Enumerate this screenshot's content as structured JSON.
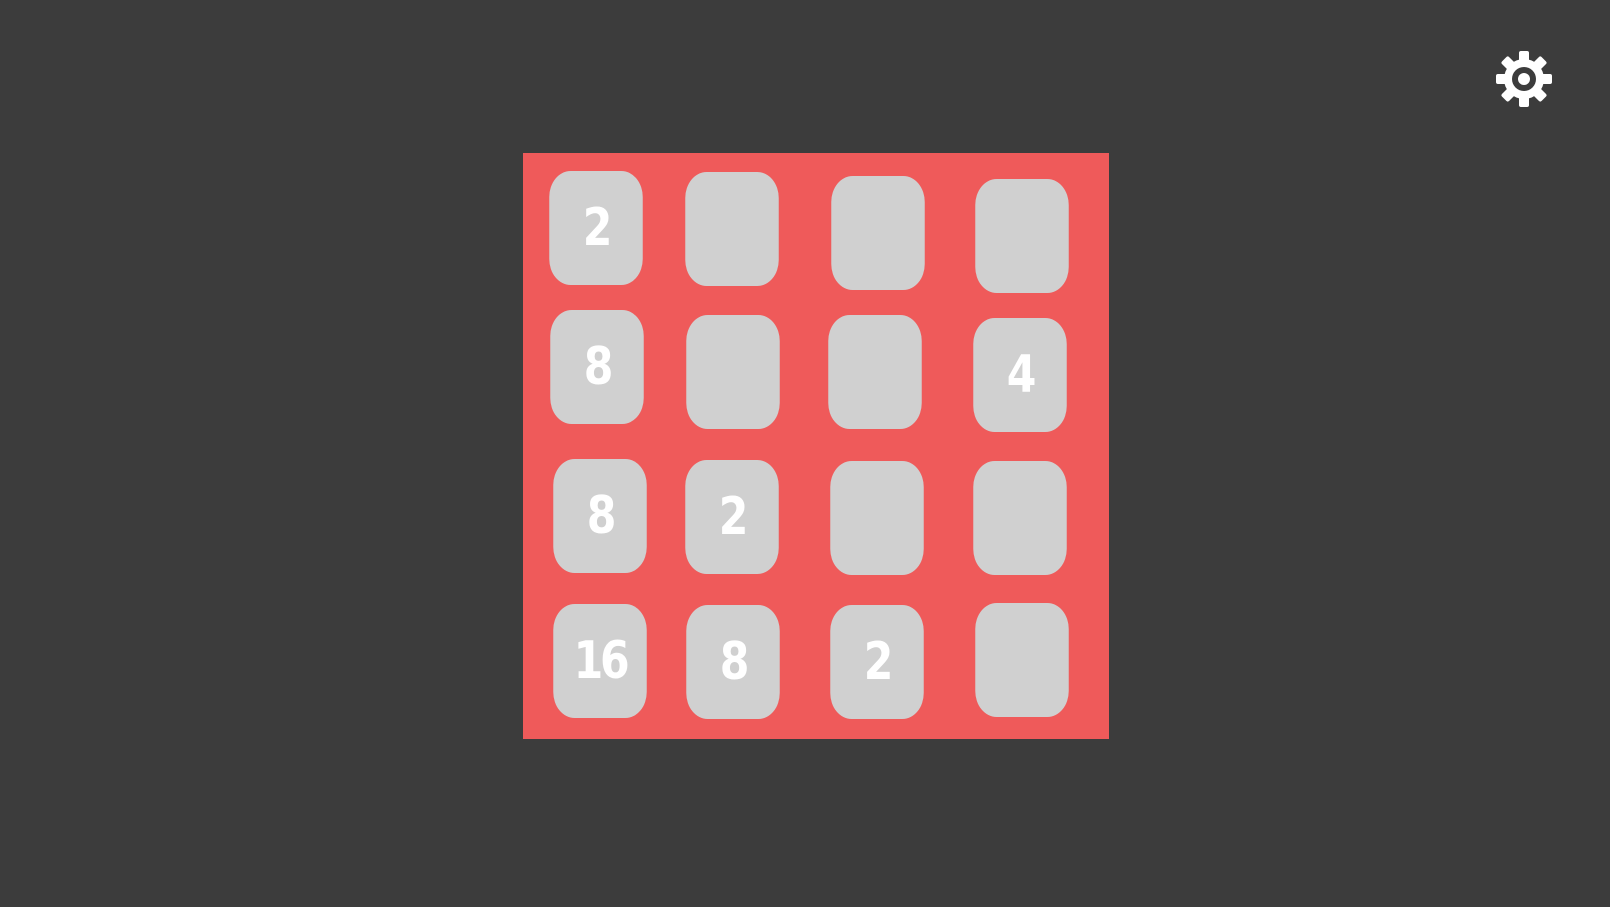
{
  "settings": {
    "icon": "gear-icon"
  },
  "board": {
    "size": 4,
    "background_color": "#ef5a5a",
    "tile_color": "#d0d0d0",
    "text_color": "#ffffff",
    "tiles": [
      [
        "2",
        "",
        "",
        ""
      ],
      [
        "8",
        "",
        "",
        "4"
      ],
      [
        "8",
        "2",
        "",
        ""
      ],
      [
        "16",
        "8",
        "2",
        ""
      ]
    ]
  }
}
